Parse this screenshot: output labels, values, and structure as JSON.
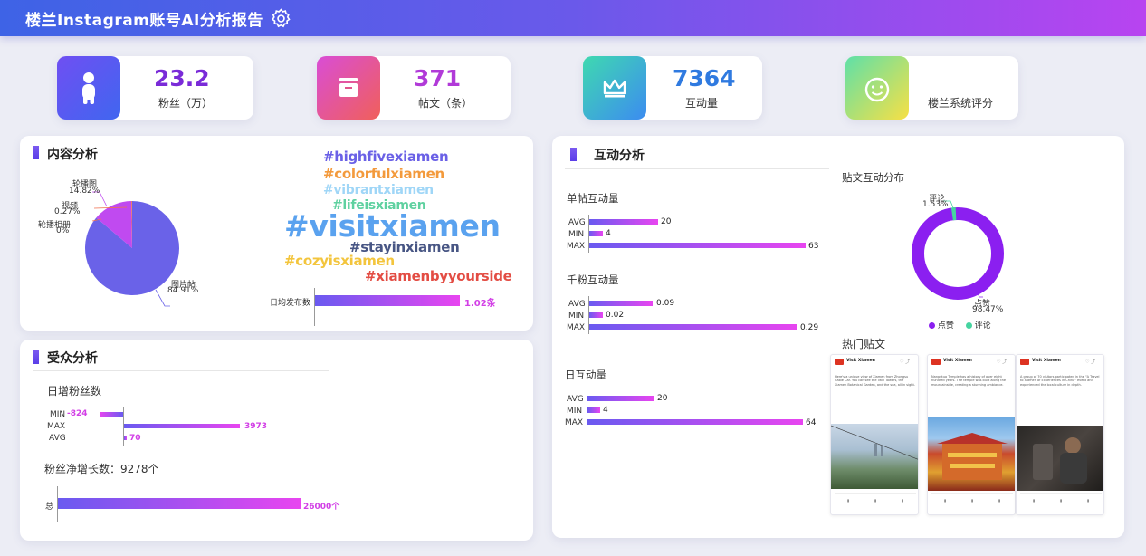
{
  "header": {
    "title": "楼兰Instagram账号AI分析报告"
  },
  "kpis": [
    {
      "value": "23.2",
      "label": "粉丝（万）",
      "color": "#7a2bd8"
    },
    {
      "value": "371",
      "label": "帖文（条）",
      "color": "#b13ad8"
    },
    {
      "value": "7364",
      "label": "互动量",
      "color": "#2f7ae0"
    },
    {
      "value": "",
      "label": "楼兰系统评分",
      "color": "#333333"
    }
  ],
  "content": {
    "title": "内容分析",
    "pie": [
      {
        "name": "轮播图",
        "pct": "14.82%",
        "value": 14.82
      },
      {
        "name": "视频",
        "pct": "0.27%",
        "value": 0.27
      },
      {
        "name": "轮播相册",
        "pct": "0%",
        "value": 0
      },
      {
        "name": "图片帖",
        "pct": "84.91%",
        "value": 84.91
      }
    ],
    "tags": [
      "#highfivexiamen",
      "#colorfulxiamen",
      "#vibrantxiamen",
      "#lifeisxiamen",
      "#visitxiamen",
      "#stayinxiamen",
      "#cozyisxiamen",
      "#xiamenbyyourside"
    ],
    "daily_label": "日均发布数",
    "daily_value": "1.02条"
  },
  "audience": {
    "title": "受众分析",
    "daily_title": "日增粉丝数",
    "rows": [
      {
        "label": "MIN",
        "value": "-824"
      },
      {
        "label": "MAX",
        "value": "3973"
      },
      {
        "label": "AVG",
        "value": "70"
      }
    ],
    "net_title": "粉丝净增长数：9278个",
    "total_label": "总",
    "total_value": "26000个"
  },
  "interaction": {
    "title": "互动分析",
    "groups": [
      {
        "title": "单帖互动量",
        "rows": [
          {
            "label": "AVG",
            "value": "20",
            "num": 20
          },
          {
            "label": "MIN",
            "value": "4",
            "num": 4
          },
          {
            "label": "MAX",
            "value": "63",
            "num": 63
          }
        ]
      },
      {
        "title": "千粉互动量",
        "rows": [
          {
            "label": "AVG",
            "value": "0.09",
            "num": 0.09
          },
          {
            "label": "MIN",
            "value": "0.02",
            "num": 0.02
          },
          {
            "label": "MAX",
            "value": "0.29",
            "num": 0.29
          }
        ]
      },
      {
        "title": "日互动量",
        "rows": [
          {
            "label": "AVG",
            "value": "20",
            "num": 20
          },
          {
            "label": "MIN",
            "value": "4",
            "num": 4
          },
          {
            "label": "MAX",
            "value": "64",
            "num": 64
          }
        ]
      }
    ],
    "donut_title": "贴文互动分布",
    "donut": [
      {
        "name": "点赞",
        "pct": "98.47%",
        "value": 98.47,
        "color": "#8b1ff0"
      },
      {
        "name": "评论",
        "pct": "1.53%",
        "value": 1.53,
        "color": "#46d4a0"
      }
    ],
    "hot_title": "热门贴文",
    "posts": [
      {
        "account": "Visit Xiamen",
        "text": "Here's a unique view of Xiamen from Zhongsu Cable Car. You can see the Twin Towers, the Xiamen Botanical Garden, and the sea, all in sight."
      },
      {
        "account": "Visit Xiamen",
        "text": "Nanputuo Temple has a history of over eight hundred years. The temple was built along the mountainside, creating a stunning ambiance."
      },
      {
        "account": "Visit Xiamen",
        "text": "A group of 70 visitors participated in the \"A Travel to Xiamen of Experiences in China\" event and experienced the local culture in depth."
      }
    ]
  }
}
